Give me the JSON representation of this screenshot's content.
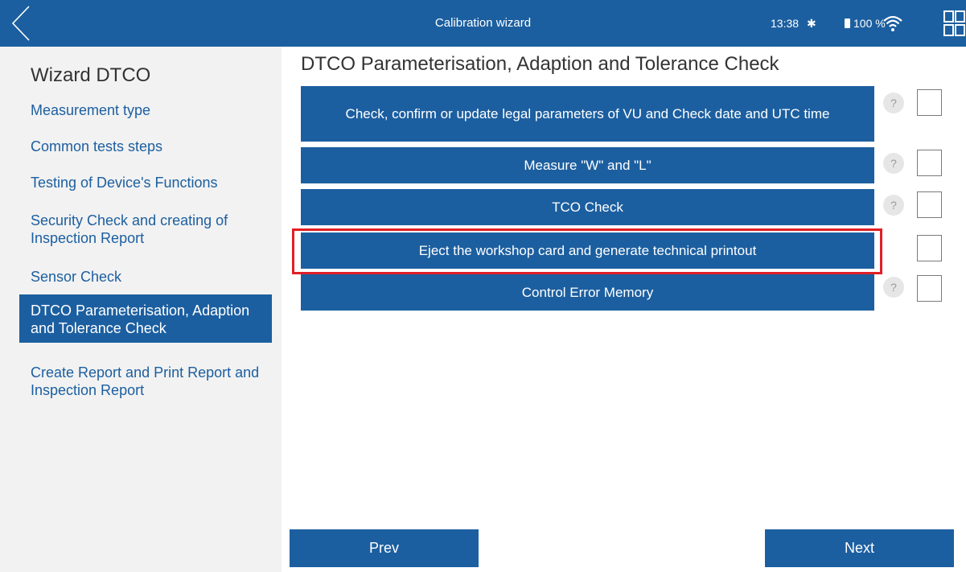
{
  "header": {
    "title": "Calibration wizard",
    "time": "13:38",
    "bluetooth_symbol": "✱",
    "battery_text": "100 %",
    "back_icon": "chevron-left-icon",
    "apps_icon": "grid-icon",
    "bar_color": "#1c5fa0"
  },
  "sidebar": {
    "title": "Wizard DTCO",
    "items": [
      {
        "label": "Measurement type",
        "active": false
      },
      {
        "label": "Common tests steps",
        "active": false
      },
      {
        "label": "Testing of Device's Functions",
        "active": false
      },
      {
        "label": "Security Check and creating of Inspection Report",
        "active": false
      },
      {
        "label": "Sensor Check",
        "active": false
      },
      {
        "label": "DTCO Parameterisation, Adaption and Tolerance Check",
        "active": true
      },
      {
        "label": "Create Report and Print Report and Inspection Report",
        "active": false
      }
    ]
  },
  "main": {
    "title": "DTCO Parameterisation, Adaption and Tolerance Check",
    "help_symbol": "?",
    "steps": [
      {
        "label": "Check, confirm or update legal parameters of VU and Check date and UTC time",
        "has_help": true,
        "checked": false,
        "highlighted": false
      },
      {
        "label": "Measure \"W\" and \"L\"",
        "has_help": true,
        "checked": false,
        "highlighted": false
      },
      {
        "label": "TCO Check",
        "has_help": true,
        "checked": false,
        "highlighted": false
      },
      {
        "label": "Eject the workshop card and generate technical printout",
        "has_help": false,
        "checked": false,
        "highlighted": true
      },
      {
        "label": "Control Error Memory",
        "has_help": true,
        "checked": false,
        "highlighted": false
      }
    ]
  },
  "footer": {
    "prev_label": "Prev",
    "next_label": "Next"
  },
  "colors": {
    "accent": "#1c5fa0",
    "highlight": "#e01f26",
    "sidebar_bg": "#f2f2f2"
  }
}
